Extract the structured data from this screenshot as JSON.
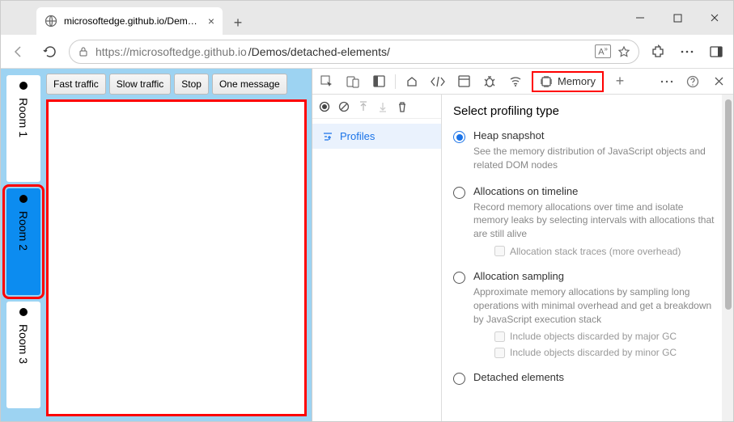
{
  "tab": {
    "title": "microsoftedge.github.io/Demos/c"
  },
  "url": {
    "host": "https://microsoftedge.github.io",
    "path": "/Demos/detached-elements/"
  },
  "rooms": [
    {
      "label": "Room 1",
      "selected": false
    },
    {
      "label": "Room 2",
      "selected": true
    },
    {
      "label": "Room 3",
      "selected": false
    }
  ],
  "traffic_buttons": {
    "fast": "Fast traffic",
    "slow": "Slow traffic",
    "stop": "Stop",
    "one": "One message"
  },
  "devtools": {
    "memory_tab": "Memory",
    "profiles": "Profiles",
    "heading": "Select profiling type",
    "options": {
      "heap": {
        "title": "Heap snapshot",
        "desc": "See the memory distribution of JavaScript objects and related DOM nodes"
      },
      "timeline": {
        "title": "Allocations on timeline",
        "desc": "Record memory allocations over time and isolate memory leaks by selecting intervals with allocations that are still alive"
      },
      "timeline_check": "Allocation stack traces (more overhead)",
      "sampling": {
        "title": "Allocation sampling",
        "desc": "Approximate memory allocations by sampling long operations with minimal overhead and get a breakdown by JavaScript execution stack"
      },
      "sampling_check_major": "Include objects discarded by major GC",
      "sampling_check_minor": "Include objects discarded by minor GC",
      "detached": {
        "title": "Detached elements"
      }
    }
  }
}
